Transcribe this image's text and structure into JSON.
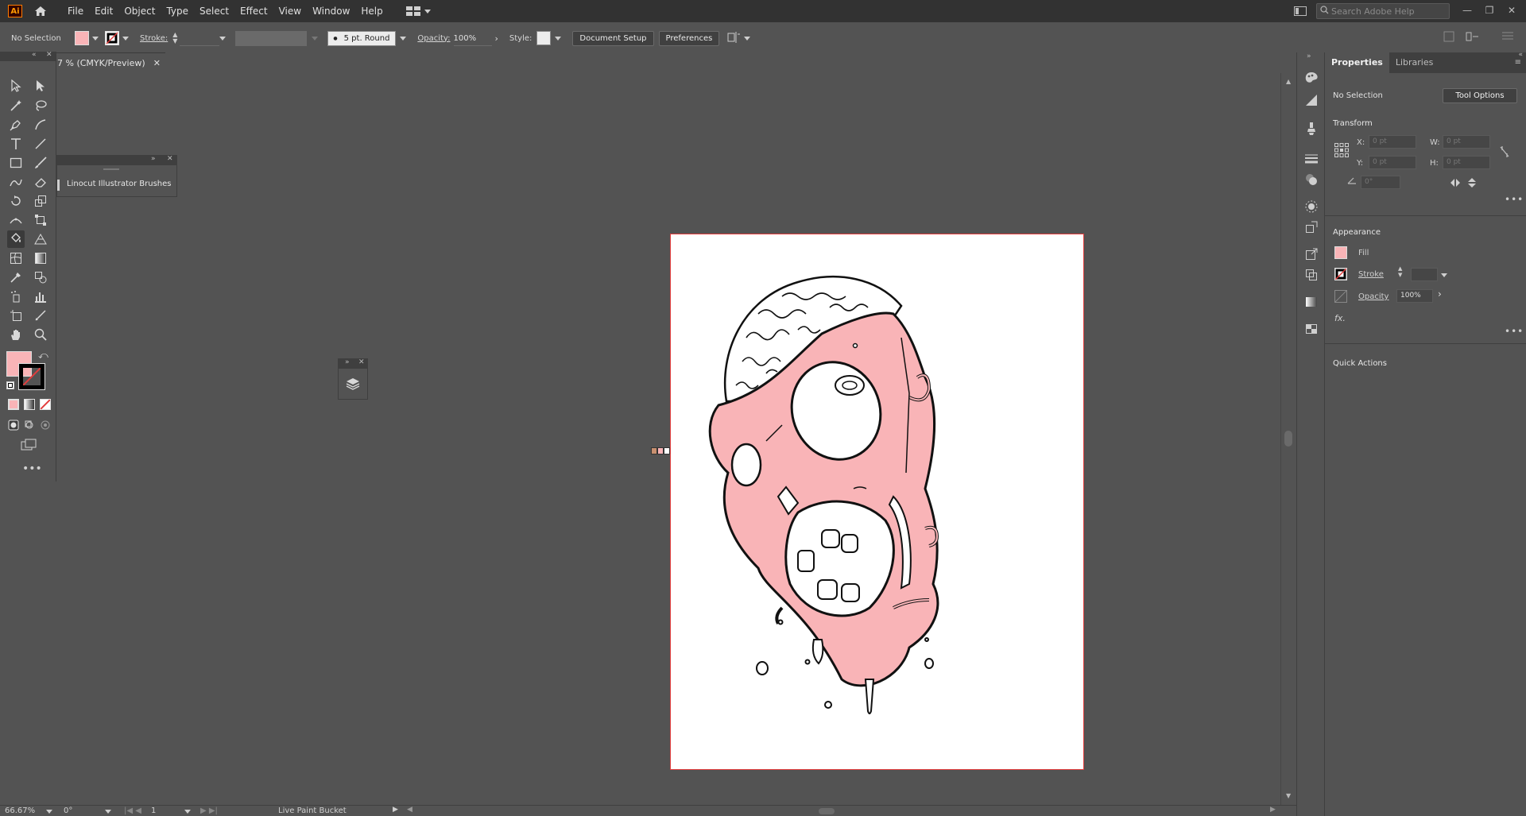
{
  "app": {
    "logo_text": "Ai"
  },
  "menu": {
    "items": [
      "File",
      "Edit",
      "Object",
      "Type",
      "Select",
      "Effect",
      "View",
      "Window",
      "Help"
    ]
  },
  "search": {
    "placeholder": "Search Adobe Help"
  },
  "control_bar": {
    "selection": "No Selection",
    "stroke_label": "Stroke:",
    "brush": "5 pt. Round",
    "opacity_label": "Opacity:",
    "opacity_value": "100%",
    "style_label": "Style:",
    "document_setup": "Document Setup",
    "preferences": "Preferences"
  },
  "document": {
    "tab_title": "7 % (CMYK/Preview)"
  },
  "brush_panel": {
    "label": "Linocut Illustrator Brushes"
  },
  "properties": {
    "tabs": [
      "Properties",
      "Libraries"
    ],
    "selection": "No Selection",
    "tool_options": "Tool Options",
    "transform_title": "Transform",
    "x_label": "X:",
    "x_value": "0 pt",
    "y_label": "Y:",
    "y_value": "0 pt",
    "w_label": "W:",
    "w_value": "0 pt",
    "h_label": "H:",
    "h_value": "0 pt",
    "angle_value": "0°",
    "appearance_title": "Appearance",
    "fill_label": "Fill",
    "stroke_label": "Stroke",
    "opacity_label": "Opacity",
    "opacity_value": "100%",
    "fx_label": "fx.",
    "quick_actions": "Quick Actions"
  },
  "status": {
    "zoom": "66.67%",
    "rotation": "0°",
    "artboard": "1",
    "tool": "Live Paint Bucket"
  },
  "colors": {
    "fill": "#f9b4b7",
    "stroke": "#000000",
    "accent_red": "#e23d3d"
  }
}
